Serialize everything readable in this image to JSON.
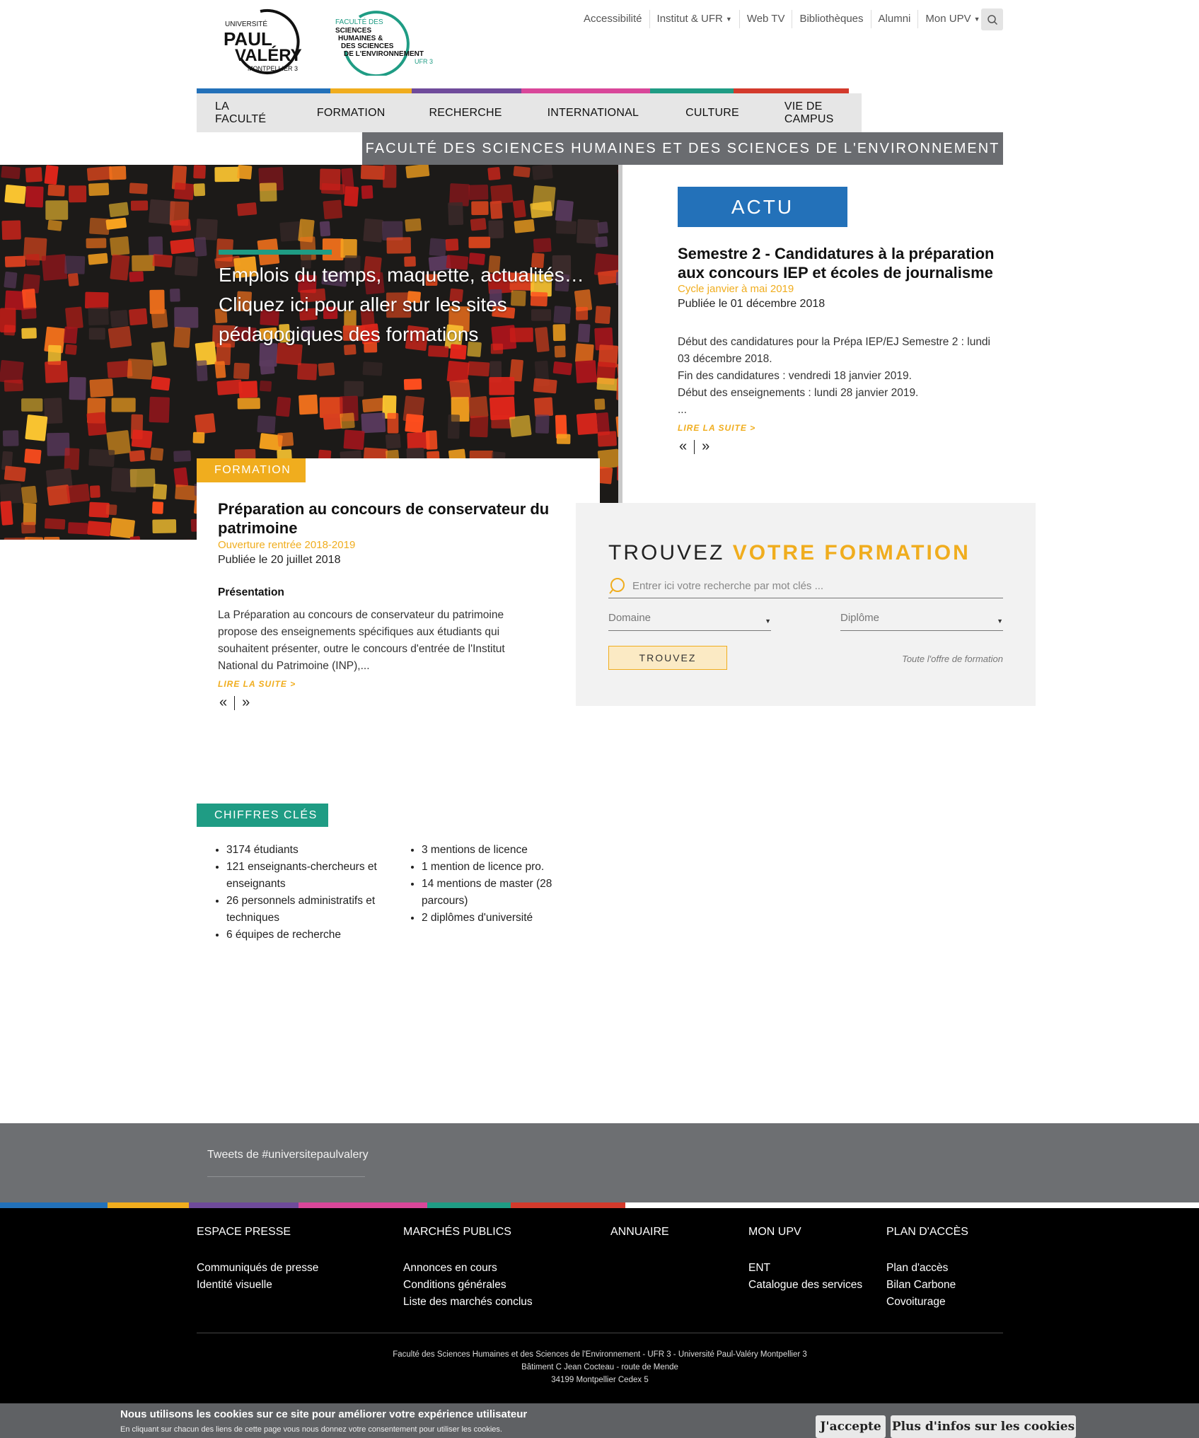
{
  "header": {
    "logo_upv": {
      "line1": "UNIVERSITÉ",
      "line2": "PAUL",
      "line3": "VALÉRY",
      "line4": "MONTPELLIER 3"
    },
    "logo_ufr": {
      "line1": "FACULTÉ DES",
      "line2": "SCIENCES",
      "line3": "HUMAINES &",
      "line4": "DES SCIENCES",
      "line5": "DE L'ENVIRONNEMENT",
      "line6": "UFR 3"
    },
    "topnav": [
      "Accessibilité",
      "Institut & UFR",
      "Web TV",
      "Bibliothèques",
      "Alumni",
      "Mon UPV"
    ],
    "mainnav": [
      "LA FACULTÉ",
      "FORMATION",
      "RECHERCHE",
      "INTERNATIONAL",
      "CULTURE",
      "VIE DE CAMPUS"
    ],
    "faculty_band": "FACULTÉ DES SCIENCES HUMAINES ET DES SCIENCES DE L'ENVIRONNEMENT"
  },
  "colors": {
    "blue": "#2371b9",
    "yellow": "#f0ad1e",
    "purple": "#6f4b9b",
    "pink": "#d9479a",
    "teal": "#1f9c84",
    "red": "#d33a2c"
  },
  "hero": {
    "text": "Emplois du temps, maquette, actualités… Cliquez ici pour aller sur les sites pédagogiques des formations"
  },
  "formation": {
    "tag": "FORMATION",
    "title": "Préparation au concours de conservateur du patrimoine",
    "subtitle": "Ouverture rentrée 2018-2019",
    "date": "Publiée le 20 juillet 2018",
    "section": "Présentation",
    "body": "La Préparation au concours de conservateur du patrimoine propose des enseignements spécifiques aux étudiants qui souhaitent présenter, outre le concours d'entrée de l'Institut National du Patrimoine (INP),...",
    "readmore": "LIRE LA SUITE  >"
  },
  "actu": {
    "tag": "ACTU",
    "title": "Semestre 2 - Candidatures à la préparation aux concours IEP et écoles de journalisme",
    "subtitle": "Cycle janvier à mai 2019",
    "date": "Publiée le 01 décembre 2018",
    "lines": [
      "Début des candidatures pour la Prépa IEP/EJ Semestre 2 :  lundi 03 décembre 2018.",
      "Fin des candidatures : vendredi 18 janvier 2019.",
      "Début des enseignements : lundi 28 janvier 2019.",
      "..."
    ],
    "readmore": "LIRE LA SUITE  >"
  },
  "pager": {
    "prev": "«",
    "next": "»"
  },
  "search": {
    "title_a": "TROUVEZ",
    "title_b": "VOTRE FORMATION",
    "placeholder": "Entrer ici votre recherche par mot clés ...",
    "domaine": "Domaine",
    "diplome": "Diplôme",
    "button": "TROUVEZ",
    "link": "Toute l'offre de formation"
  },
  "chiffres": {
    "tag": "CHIFFRES CLÉS",
    "col1": [
      "3174 étudiants",
      "121 enseignants-chercheurs et enseignants",
      "26 personnels administratifs et techniques",
      "6 équipes de recherche"
    ],
    "col2": [
      "3 mentions de licence",
      "1 mention de licence pro.",
      "14 mentions de master (28 parcours)",
      "2 diplômes d'université"
    ]
  },
  "tweets": {
    "label": "Tweets de #universitepaulvalery"
  },
  "footer": {
    "cols": [
      {
        "title": "ESPACE PRESSE",
        "links": [
          "Communiqués de presse",
          "Identité visuelle"
        ]
      },
      {
        "title": "MARCHÉS PUBLICS",
        "links": [
          "Annonces en cours",
          "Conditions générales",
          "Liste des marchés conclus"
        ]
      },
      {
        "title": "ANNUAIRE",
        "links": []
      },
      {
        "title": "MON UPV",
        "links": [
          "ENT",
          "Catalogue des services"
        ]
      },
      {
        "title": "PLAN D'ACCÈS",
        "links": [
          "Plan d'accès",
          "Bilan Carbone",
          "Covoiturage"
        ]
      }
    ],
    "address": [
      "Faculté des Sciences Humaines et des Sciences de l'Environnement - UFR 3 - Université Paul-Valéry Montpellier 3",
      "Bâtiment C Jean Cocteau - route de Mende",
      "34199 Montpellier Cedex 5"
    ]
  },
  "cookie": {
    "title": "Nous utilisons les cookies sur ce site pour améliorer votre expérience utilisateur",
    "sub": "En cliquant sur chacun des liens de cette page vous nous donnez votre consentement pour utiliser les cookies.",
    "accept": "J'accepte",
    "more": "Plus d'infos sur les cookies"
  }
}
